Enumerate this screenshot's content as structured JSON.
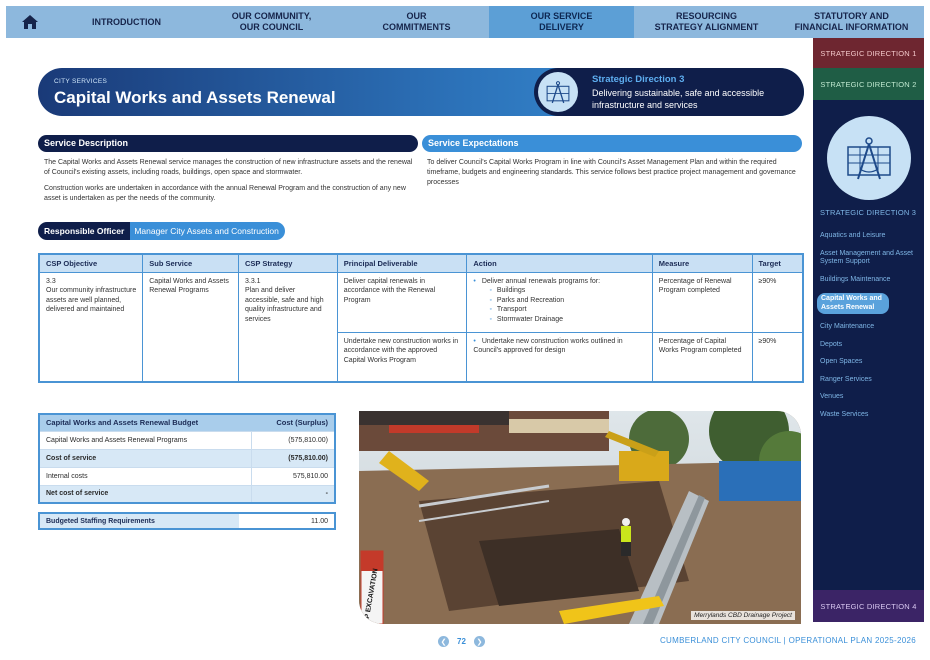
{
  "nav": {
    "home_icon": "home-icon",
    "items": [
      {
        "line1": "INTRODUCTION",
        "line2": ""
      },
      {
        "line1": "OUR COMMUNITY,",
        "line2": "OUR COUNCIL"
      },
      {
        "line1": "OUR",
        "line2": "COMMITMENTS"
      },
      {
        "line1": "OUR SERVICE",
        "line2": "DELIVERY"
      },
      {
        "line1": "RESOURCING",
        "line2": "STRATEGY ALIGNMENT"
      },
      {
        "line1": "STATUTORY AND",
        "line2": "FINANCIAL INFORMATION"
      }
    ],
    "active_index": 3
  },
  "sidebar": {
    "direction1": "STRATEGIC DIRECTION 1",
    "direction2": "STRATEGIC DIRECTION 2",
    "direction3": "STRATEGIC DIRECTION 3",
    "direction4": "STRATEGIC DIRECTION 4",
    "emblem_icon": "compass-drafting-icon",
    "items": [
      "Aquatics and Leisure",
      "Asset Management and Asset System Support",
      "Buildings Maintenance",
      "Capital Works and Assets Renewal",
      "City Maintenance",
      "Depots",
      "Open Spaces",
      "Ranger Services",
      "Venues",
      "Waste Services"
    ],
    "active_item": "Capital Works and Assets Renewal"
  },
  "header": {
    "eyebrow": "CITY SERVICES",
    "title": "Capital Works and Assets Renewal",
    "direction_title": "Strategic Direction 3",
    "direction_text": "Delivering sustainable, safe and accessible infrastructure and services"
  },
  "service_description": {
    "heading": "Service Description",
    "para1": "The Capital Works and Assets Renewal service manages the construction of new infrastructure assets and the renewal of Council's existing assets, including roads, buildings, open space and stormwater.",
    "para2": "Construction works are undertaken in accordance with the annual Renewal Program and the construction of any new asset is undertaken as per the needs of the community."
  },
  "service_expectations": {
    "heading": "Service Expectations",
    "text": "To deliver Council's Capital Works Program in line with Council's Asset Management Plan and within the required timeframe, budgets and engineering standards. This service follows best practice project management and governance processes"
  },
  "officer": {
    "label": "Responsible Officer",
    "value": "Manager City Assets and Construction"
  },
  "table": {
    "headers": [
      "CSP Objective",
      "Sub Service",
      "CSP Strategy",
      "Principal Deliverable",
      "Action",
      "Measure",
      "Target"
    ],
    "objective_code": "3.3",
    "objective": "Our community infrastructure assets are well planned, delivered and maintained",
    "sub_service": "Capital Works and Assets Renewal Programs",
    "strategy_code": "3.3.1",
    "strategy": "Plan and deliver accessible, safe and high quality infrastructure and services",
    "rows": [
      {
        "deliverable": "Deliver capital renewals in accordance with the Renewal Program",
        "action": "Deliver annual renewals programs for:",
        "subitems": [
          "Buildings",
          "Parks and Recreation",
          "Transport",
          "Stormwater Drainage"
        ],
        "measure": "Percentage of Renewal Program completed",
        "target": "≥90%"
      },
      {
        "deliverable": "Undertake new construction works in accordance with the approved Capital Works Program",
        "action": "Undertake new construction works outlined in Council's approved for design",
        "measure": "Percentage of Capital Works Program completed",
        "target": "≥90%"
      }
    ]
  },
  "budget": {
    "header_label": "Capital Works and Assets Renewal Budget",
    "header_cost": "Cost (Surplus)",
    "rows": [
      {
        "label": "Capital Works and Assets Renewal Programs",
        "value": "(575,810.00)"
      },
      {
        "label": "Cost of service",
        "value": "(575,810.00)"
      },
      {
        "label": "Internal costs",
        "value": "575,810.00"
      },
      {
        "label": "Net cost of service",
        "value": "-"
      }
    ],
    "staffing_label": "Budgeted Staffing Requirements",
    "staffing_value": "11.00"
  },
  "photo": {
    "caption": "Merrylands CBD Drainage Project",
    "sign_text": "DEEP EXCAVATION"
  },
  "footer": {
    "page": "72",
    "org": "CUMBERLAND CITY COUNCIL",
    "separator": "|",
    "doc": "OPERATIONAL PLAN 2025-2026"
  }
}
